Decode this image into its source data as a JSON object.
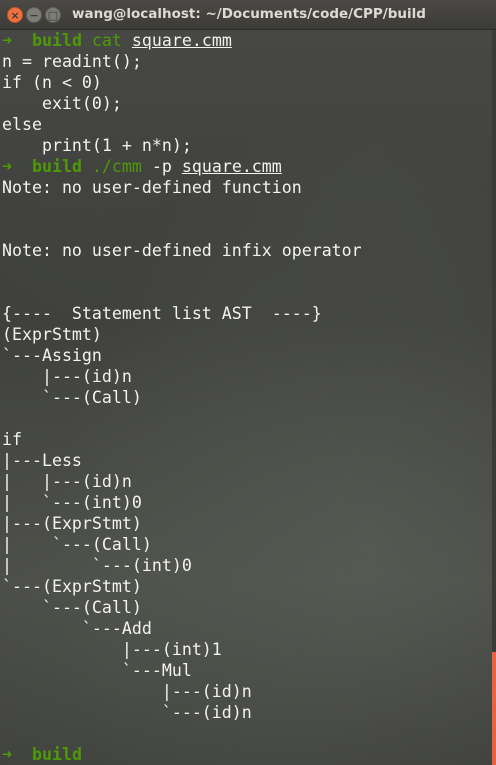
{
  "window": {
    "title": "wang@localhost: ~/Documents/code/CPP/build",
    "close_glyph": "×",
    "minimize_glyph": "−",
    "maximize_glyph": "□"
  },
  "terminal": {
    "prompt_arrow": "➜",
    "prompt_dir": "build",
    "cmd1": {
      "program": "cat",
      "arg": "square.cmm"
    },
    "file_lines": [
      "n = readint();",
      "if (n < 0)",
      "    exit(0);",
      "else",
      "    print(1 + n*n);"
    ],
    "cmd2": {
      "program": "./cmm",
      "flag": "-p",
      "arg": "square.cmm"
    },
    "output_lines": [
      "Note: no user-defined function",
      "",
      "",
      "Note: no user-defined infix operator",
      "",
      "",
      "{----  Statement list AST  ----}",
      "(ExprStmt)",
      "`---Assign",
      "    |---(id)n",
      "    `---(Call)",
      "",
      "if",
      "|---Less",
      "|   |---(id)n",
      "|   `---(int)0",
      "|---(ExprStmt)",
      "|    `---(Call)",
      "|        `---(int)0",
      "`---(ExprStmt)",
      "    `---(Call)",
      "        `---Add",
      "            |---(int)1",
      "            `---Mul",
      "                |---(id)n",
      "                `---(id)n",
      ""
    ],
    "final_prompt_dir": "build"
  },
  "colors": {
    "prompt_green": "#4e9a06",
    "text": "#f2f2f0",
    "close_button": "#f0713e",
    "scroll_thumb": "#e9623f"
  },
  "scroll_position": 0.85
}
